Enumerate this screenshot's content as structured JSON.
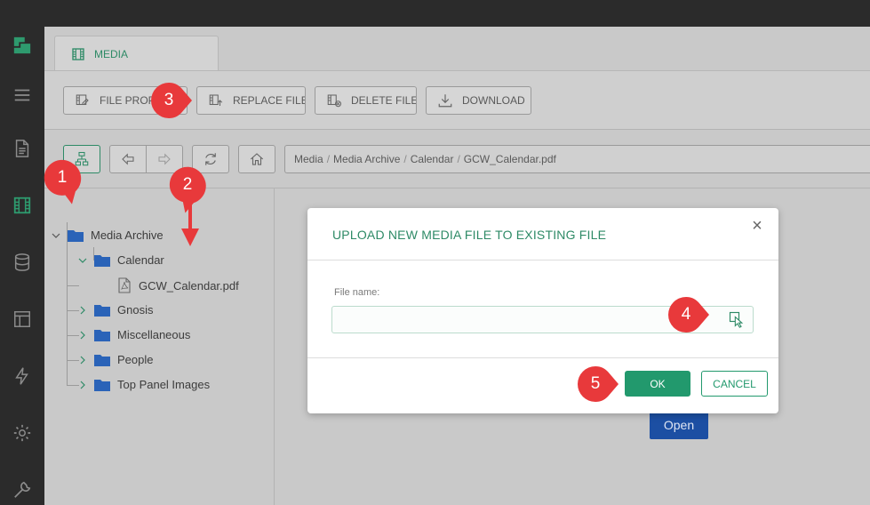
{
  "tab": {
    "label": "MEDIA",
    "icon": "film-icon"
  },
  "toolbar": {
    "file_props": "FILE PROPERTIES",
    "replace_file": "REPLACE FILE",
    "delete_file": "DELETE FILE",
    "download": "DOWNLOAD"
  },
  "breadcrumb": [
    "Media",
    "Media Archive",
    "Calendar",
    "GCW_Calendar.pdf"
  ],
  "tree": {
    "root": "Media Archive",
    "calendar": "Calendar",
    "file": "GCW_Calendar.pdf",
    "gnosis": "Gnosis",
    "misc": "Miscellaneous",
    "people": "People",
    "top_panel": "Top Panel Images"
  },
  "content": {
    "open_label": "Open"
  },
  "dialog": {
    "title": "UPLOAD NEW MEDIA FILE TO EXISTING FILE",
    "close": "×",
    "field_label": "File name:",
    "field_value": "",
    "ok": "OK",
    "cancel": "CANCEL"
  },
  "callouts": [
    "1",
    "2",
    "3",
    "4",
    "5"
  ],
  "colors": {
    "accent": "#22996d",
    "callout": "#e8393b",
    "sidebar": "#2b2b2b",
    "open_button": "#1c4fa3"
  }
}
